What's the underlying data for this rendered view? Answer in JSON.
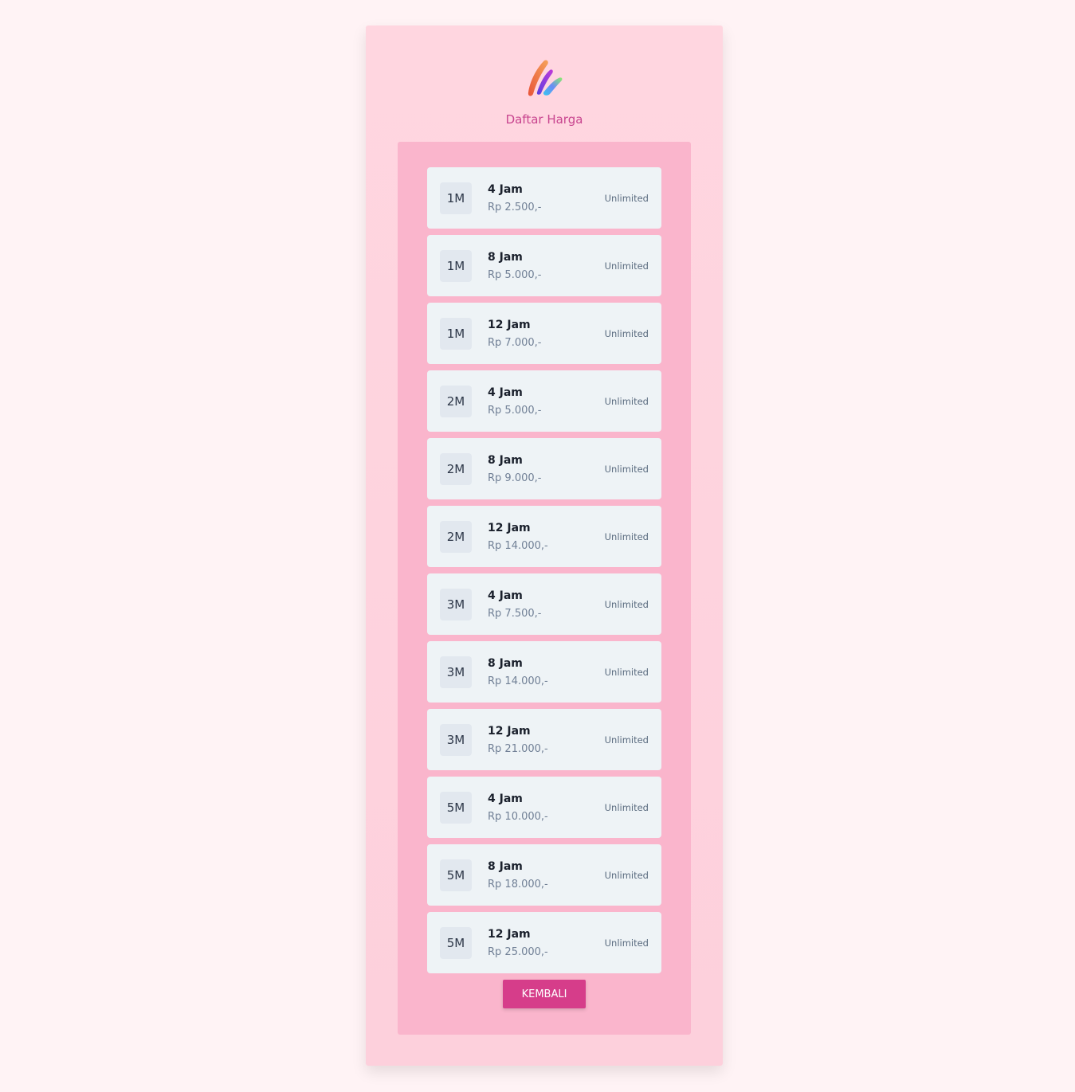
{
  "header": {
    "logo_icon": "brush-strokes-logo",
    "title": "Daftar Harga"
  },
  "packages": [
    {
      "quota": "1M",
      "duration": "4 Jam",
      "price": "Rp 2.500,-",
      "limit": "Unlimited"
    },
    {
      "quota": "1M",
      "duration": "8 Jam",
      "price": "Rp 5.000,-",
      "limit": "Unlimited"
    },
    {
      "quota": "1M",
      "duration": "12 Jam",
      "price": "Rp 7.000,-",
      "limit": "Unlimited"
    },
    {
      "quota": "2M",
      "duration": "4 Jam",
      "price": "Rp 5.000,-",
      "limit": "Unlimited"
    },
    {
      "quota": "2M",
      "duration": "8 Jam",
      "price": "Rp 9.000,-",
      "limit": "Unlimited"
    },
    {
      "quota": "2M",
      "duration": "12 Jam",
      "price": "Rp 14.000,-",
      "limit": "Unlimited"
    },
    {
      "quota": "3M",
      "duration": "4 Jam",
      "price": "Rp 7.500,-",
      "limit": "Unlimited"
    },
    {
      "quota": "3M",
      "duration": "8 Jam",
      "price": "Rp 14.000,-",
      "limit": "Unlimited"
    },
    {
      "quota": "3M",
      "duration": "12 Jam",
      "price": "Rp 21.000,-",
      "limit": "Unlimited"
    },
    {
      "quota": "5M",
      "duration": "4 Jam",
      "price": "Rp 10.000,-",
      "limit": "Unlimited"
    },
    {
      "quota": "5M",
      "duration": "8 Jam",
      "price": "Rp 18.000,-",
      "limit": "Unlimited"
    },
    {
      "quota": "5M",
      "duration": "12 Jam",
      "price": "Rp 25.000,-",
      "limit": "Unlimited"
    }
  ],
  "actions": {
    "back_label": "KEMBALI"
  },
  "colors": {
    "page_background": "#fff3f5",
    "card_background": "#ffd6e0",
    "panel_background": "#fab5cc",
    "item_background": "#eef3f6",
    "accent": "#d63d8a",
    "title_color": "#c8458f"
  }
}
